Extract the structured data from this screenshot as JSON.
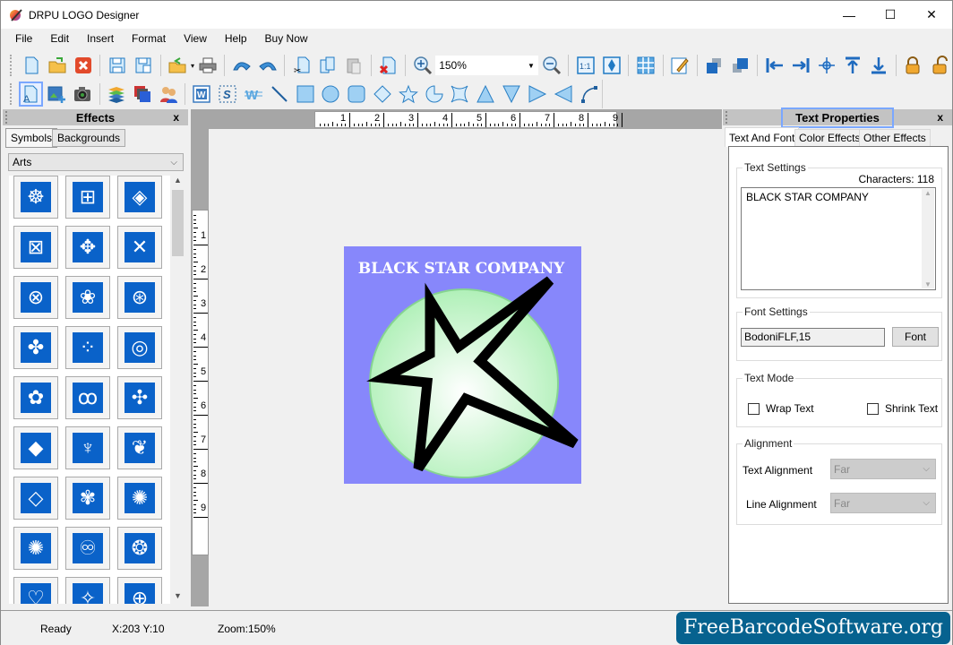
{
  "window": {
    "title": "DRPU LOGO Designer",
    "minimize": "—",
    "maximize": "☐",
    "close": "✕"
  },
  "menu": [
    "File",
    "Edit",
    "Insert",
    "Format",
    "View",
    "Help",
    "Buy Now"
  ],
  "toolbar1": {
    "zoom_value": "150%",
    "buttons": [
      "new",
      "open",
      "close",
      "save",
      "save-as",
      "export",
      "print",
      "undo",
      "redo",
      "cut",
      "copy",
      "paste",
      "delete",
      "zoom-in",
      "zoom-out",
      "actual-size",
      "fit-to-window",
      "grid",
      "edit",
      "bring-to-front",
      "send-to-back",
      "align-left",
      "align-right",
      "align-center",
      "align-top",
      "align-bottom",
      "lock",
      "unlock"
    ]
  },
  "toolbar2": {
    "buttons": [
      "text",
      "image",
      "camera",
      "layers",
      "background",
      "users",
      "word-art",
      "signature",
      "watermark",
      "line",
      "rectangle",
      "ellipse",
      "rounded-rectangle",
      "diamond",
      "star",
      "arc",
      "cross-star",
      "triangle",
      "inverted-triangle",
      "right-triangle",
      "left-triangle",
      "curve"
    ]
  },
  "effects_panel": {
    "title": "Effects",
    "close": "x",
    "tabs": [
      "Symbols",
      "Backgrounds"
    ],
    "active_tab": "Symbols",
    "category": "Arts",
    "symbols": [
      "☸",
      "⊞",
      "◈",
      "⊠",
      "✥",
      "✕",
      "⊗",
      "❀",
      "⊛",
      "✤",
      "⁘",
      "◎",
      "✿",
      "ꝏ",
      "✣",
      "◆",
      "♆",
      "❦",
      "◇",
      "✾",
      "✺",
      "✺",
      "♾",
      "❂",
      "♡",
      "✧",
      "⊕"
    ]
  },
  "canvas": {
    "h_ruler": [
      "1",
      "2",
      "3",
      "4",
      "5",
      "6",
      "7",
      "8",
      "9"
    ],
    "v_ruler": [
      "1",
      "2",
      "3",
      "4",
      "5",
      "6",
      "7",
      "8",
      "9"
    ],
    "logo": {
      "text": "BLACK STAR COMPANY",
      "background_color": "#8787fb",
      "circle_color": "#b4f0b4",
      "star_color": "#000000",
      "text_color": "#ffffff"
    }
  },
  "text_properties": {
    "title": "Text Properties",
    "close": "x",
    "tabs": [
      "Text And Font",
      "Color Effects",
      "Other Effects"
    ],
    "active_tab": "Text And Font",
    "text_settings": {
      "legend": "Text Settings",
      "characters_label": "Characters: 118",
      "text": "BLACK STAR COMPANY"
    },
    "font_settings": {
      "legend": "Font Settings",
      "font_value": "BodoniFLF,15",
      "font_button": "Font"
    },
    "text_mode": {
      "legend": "Text Mode",
      "wrap_text": "Wrap Text",
      "wrap_checked": false,
      "shrink_text": "Shrink Text",
      "shrink_checked": false
    },
    "alignment": {
      "legend": "Alignment",
      "text_alignment_label": "Text Alignment",
      "text_alignment_value": "Far",
      "line_alignment_label": "Line Alignment",
      "line_alignment_value": "Far"
    }
  },
  "status": {
    "ready": "Ready",
    "coords": "X:203  Y:10",
    "zoom": "Zoom:150%",
    "brand": "FreeBarcodeSoftware.org"
  }
}
